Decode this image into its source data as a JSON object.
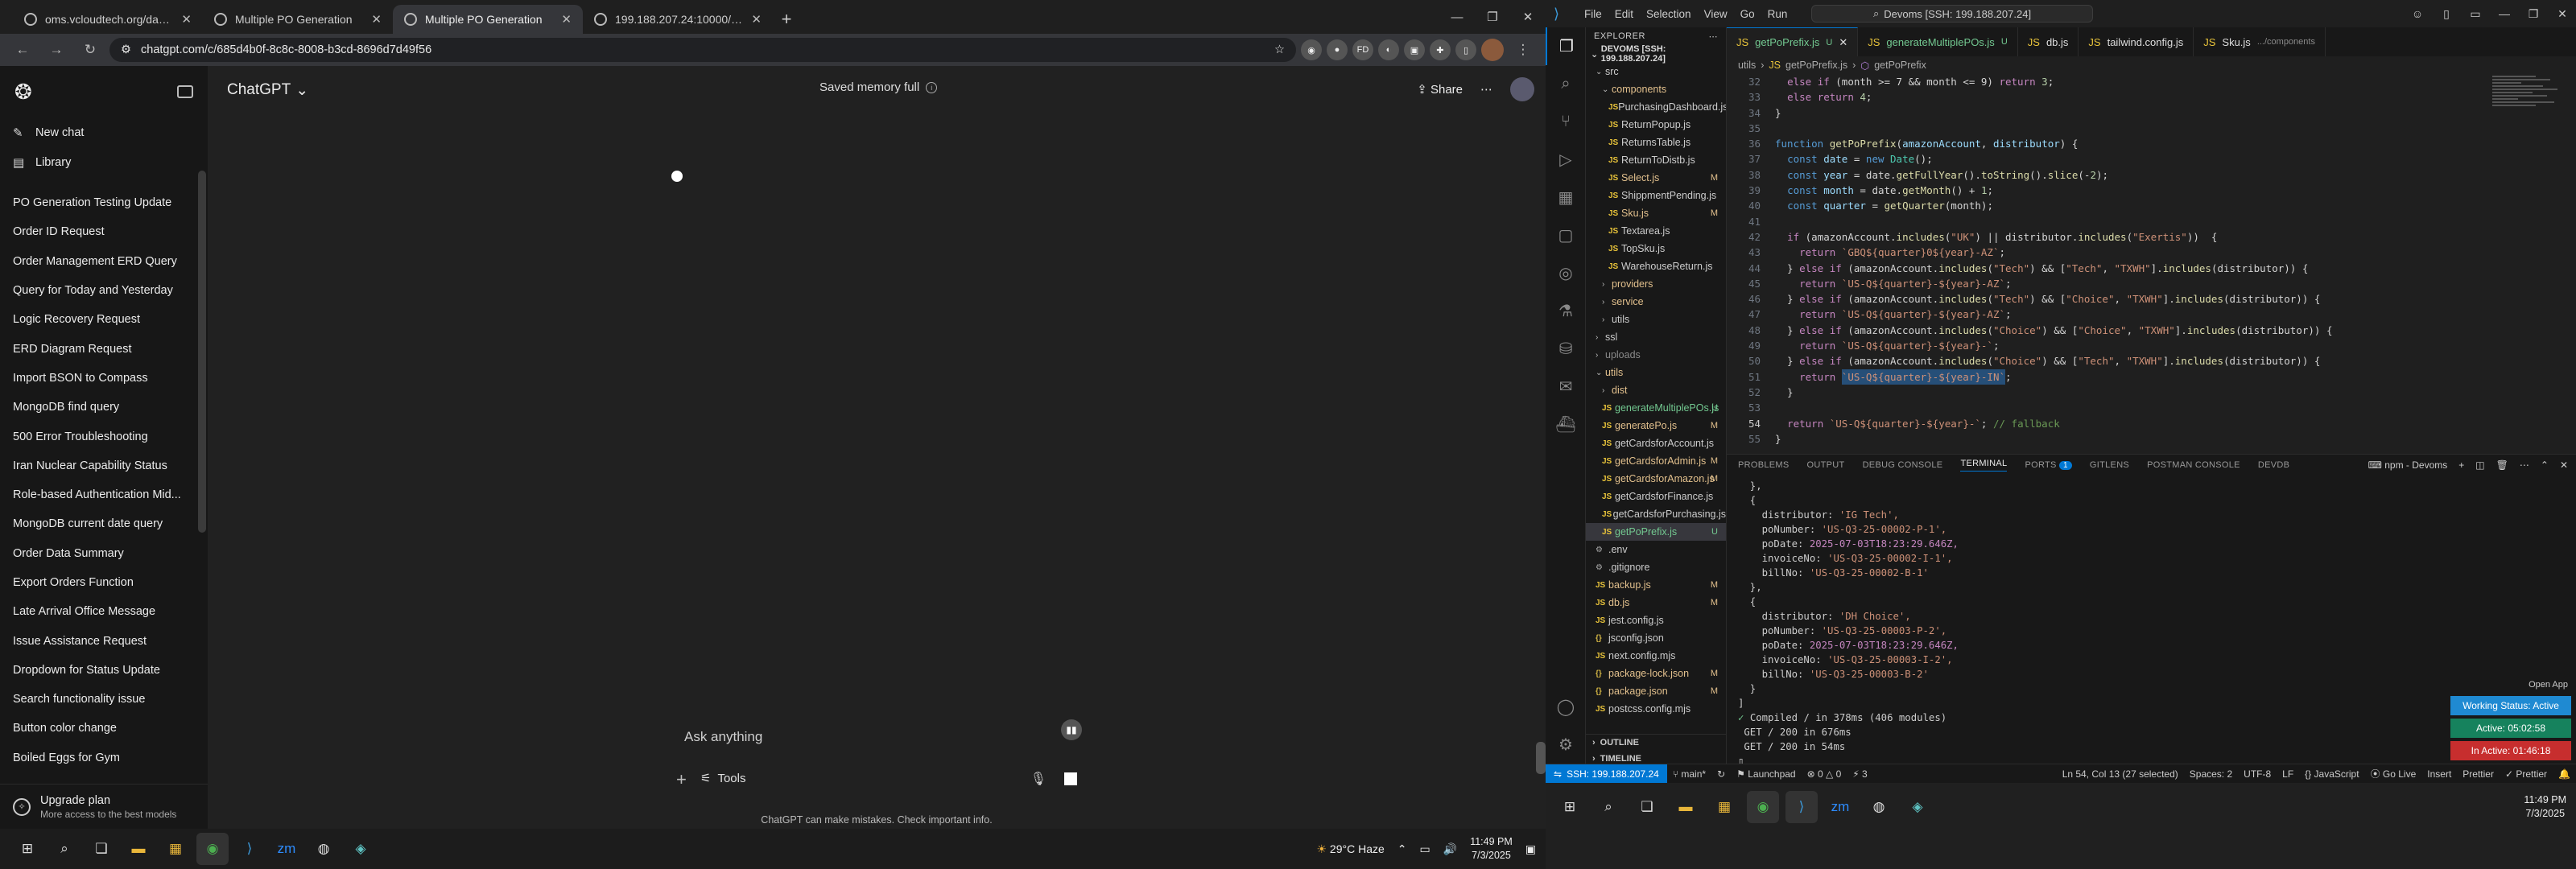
{
  "chrome": {
    "tabs": [
      {
        "title": "oms.vcloudtech.org/dashboard",
        "active": false
      },
      {
        "title": "Multiple PO Generation",
        "active": false
      },
      {
        "title": "Multiple PO Generation",
        "active": true
      },
      {
        "title": "199.188.207.24:10000/orders/0",
        "active": false
      }
    ],
    "new_tab": "+",
    "url": "chatgpt.com/c/685d4b0f-8c8c-8008-b3cd-8696d7d49f56"
  },
  "sidebar": {
    "nav": [
      {
        "label": "New chat",
        "icon": "✎"
      },
      {
        "label": "Library",
        "icon": "▤"
      }
    ],
    "chats": [
      "PO Generation Testing Update",
      "Order ID Request",
      "Order Management ERD Query",
      "Query for Today and Yesterday",
      "Logic Recovery Request",
      "ERD Diagram Request",
      "Import BSON to Compass",
      "MongoDB find query",
      "500 Error Troubleshooting",
      "Iran Nuclear Capability Status",
      "Role-based Authentication Mid...",
      "MongoDB current date query",
      "Order Data Summary",
      "Export Orders Function",
      "Late Arrival Office Message",
      "Issue Assistance Request",
      "Dropdown for Status Update",
      "Search functionality issue",
      "Button color change",
      "Boiled Eggs for Gym"
    ],
    "upgrade_title": "Upgrade plan",
    "upgrade_sub": "More access to the best models"
  },
  "main": {
    "model": "ChatGPT",
    "memory": "Saved memory full",
    "share": "Share",
    "placeholder": "Ask anything",
    "tools": "Tools",
    "disclaimer": "ChatGPT can make mistakes. Check important info."
  },
  "taskbar_left": {
    "weather": "29°C Haze",
    "time": "11:49 PM",
    "date": "7/3/2025"
  },
  "vscode": {
    "menus": [
      "File",
      "Edit",
      "Selection",
      "View",
      "Go",
      "Run"
    ],
    "command_center": "Devoms [SSH: 199.188.207.24]",
    "explorer_title": "EXPLORER",
    "project": "DEVOMS [SSH: 199.188.207.24]",
    "tree": [
      {
        "d": 1,
        "t": "folder",
        "open": true,
        "name": "src",
        "s": ""
      },
      {
        "d": 2,
        "t": "folder",
        "open": true,
        "name": "components",
        "s": "",
        "cls": "mod"
      },
      {
        "d": 3,
        "t": "js",
        "name": "PurchasingDashboard.js",
        "s": ""
      },
      {
        "d": 3,
        "t": "js",
        "name": "ReturnPopup.js",
        "s": ""
      },
      {
        "d": 3,
        "t": "js",
        "name": "ReturnsTable.js",
        "s": ""
      },
      {
        "d": 3,
        "t": "js",
        "name": "ReturnToDistb.js",
        "s": ""
      },
      {
        "d": 3,
        "t": "js",
        "name": "Select.js",
        "s": "M",
        "cls": "mod"
      },
      {
        "d": 3,
        "t": "js",
        "name": "ShippmentPending.js",
        "s": ""
      },
      {
        "d": 3,
        "t": "js",
        "name": "Sku.js",
        "s": "M",
        "cls": "mod"
      },
      {
        "d": 3,
        "t": "js",
        "name": "Textarea.js",
        "s": ""
      },
      {
        "d": 3,
        "t": "js",
        "name": "TopSku.js",
        "s": ""
      },
      {
        "d": 3,
        "t": "js",
        "name": "WarehouseReturn.js",
        "s": ""
      },
      {
        "d": 2,
        "t": "folder",
        "open": false,
        "name": "providers",
        "s": "",
        "cls": "mod"
      },
      {
        "d": 2,
        "t": "folder",
        "open": false,
        "name": "service",
        "s": "",
        "cls": "mod"
      },
      {
        "d": 2,
        "t": "folder",
        "open": false,
        "name": "utils",
        "s": ""
      },
      {
        "d": 1,
        "t": "folder",
        "open": false,
        "name": "ssl",
        "s": ""
      },
      {
        "d": 1,
        "t": "folder",
        "open": false,
        "name": "uploads",
        "s": "",
        "cls": "dim"
      },
      {
        "d": 1,
        "t": "folder",
        "open": true,
        "name": "utils",
        "s": "",
        "cls": "mod"
      },
      {
        "d": 2,
        "t": "folder",
        "open": false,
        "name": "dist",
        "s": "",
        "cls": "mod"
      },
      {
        "d": 2,
        "t": "js",
        "name": "generateMultiplePOs.js",
        "s": "U",
        "cls": "unt"
      },
      {
        "d": 2,
        "t": "js",
        "name": "generatePo.js",
        "s": "M",
        "cls": "mod"
      },
      {
        "d": 2,
        "t": "js",
        "name": "getCardsforAccount.js",
        "s": ""
      },
      {
        "d": 2,
        "t": "js",
        "name": "getCardsforAdmin.js",
        "s": "M",
        "cls": "mod"
      },
      {
        "d": 2,
        "t": "js",
        "name": "getCardsforAmazon.js",
        "s": "M",
        "cls": "mod"
      },
      {
        "d": 2,
        "t": "js",
        "name": "getCardsforFinance.js",
        "s": ""
      },
      {
        "d": 2,
        "t": "js",
        "name": "getCardsforPurchasing.js",
        "s": ""
      },
      {
        "d": 2,
        "t": "js",
        "name": "getPoPrefix.js",
        "s": "U",
        "cls": "unt",
        "sel": true
      },
      {
        "d": 1,
        "t": "cfg",
        "name": ".env",
        "s": ""
      },
      {
        "d": 1,
        "t": "cfg",
        "name": ".gitignore",
        "s": ""
      },
      {
        "d": 1,
        "t": "js",
        "name": "backup.js",
        "s": "M",
        "cls": "mod"
      },
      {
        "d": 1,
        "t": "js",
        "name": "db.js",
        "s": "M",
        "cls": "mod"
      },
      {
        "d": 1,
        "t": "js",
        "name": "jest.config.js",
        "s": ""
      },
      {
        "d": 1,
        "t": "json",
        "name": "jsconfig.json",
        "s": ""
      },
      {
        "d": 1,
        "t": "js",
        "name": "next.config.mjs",
        "s": ""
      },
      {
        "d": 1,
        "t": "json",
        "name": "package-lock.json",
        "s": "M",
        "cls": "mod"
      },
      {
        "d": 1,
        "t": "json",
        "name": "package.json",
        "s": "M",
        "cls": "mod"
      },
      {
        "d": 1,
        "t": "js",
        "name": "postcss.config.mjs",
        "s": ""
      }
    ],
    "outline": "OUTLINE",
    "timeline": "TIMELINE",
    "tabs": [
      {
        "name": "getPoPrefix.js",
        "badge": "U",
        "active": true
      },
      {
        "name": "generateMultiplePOs.js",
        "badge": "U",
        "active": false
      },
      {
        "name": "db.js",
        "badge": "",
        "active": false
      },
      {
        "name": "tailwind.config.js",
        "badge": "",
        "active": false
      },
      {
        "name": "Sku.js",
        "badge": ".../components",
        "active": false
      }
    ],
    "breadcrumb": [
      "utils",
      "getPoPrefix.js",
      "getPoPrefix"
    ],
    "code_start": 32,
    "current_line": 54,
    "panel_tabs": [
      "PROBLEMS",
      "OUTPUT",
      "DEBUG CONSOLE",
      "TERMINAL",
      "PORTS",
      "GITLENS",
      "POSTMAN CONSOLE",
      "DEVDB"
    ],
    "ports_badge": "1",
    "terminal_name": "npm - Devoms",
    "terminal": [
      {
        "k": "",
        "v": "  },"
      },
      {
        "k": "",
        "v": "  {"
      },
      {
        "k": "    distributor: ",
        "v": "'IG Tech',"
      },
      {
        "k": "    poNumber: ",
        "v": "'US-Q3-25-00002-P-1',"
      },
      {
        "k": "    poDate: ",
        "v": "2025-07-03T18:23:29.646Z,",
        "date": true
      },
      {
        "k": "    invoiceNo: ",
        "v": "'US-Q3-25-00002-I-1',"
      },
      {
        "k": "    billNo: ",
        "v": "'US-Q3-25-00002-B-1'"
      },
      {
        "k": "",
        "v": "  },"
      },
      {
        "k": "",
        "v": "  {"
      },
      {
        "k": "    distributor: ",
        "v": "'DH Choice',"
      },
      {
        "k": "    poNumber: ",
        "v": "'US-Q3-25-00003-P-2',"
      },
      {
        "k": "    poDate: ",
        "v": "2025-07-03T18:23:29.646Z,",
        "date": true
      },
      {
        "k": "    invoiceNo: ",
        "v": "'US-Q3-25-00003-I-2',"
      },
      {
        "k": "    billNo: ",
        "v": "'US-Q3-25-00003-B-2'"
      },
      {
        "k": "",
        "v": "  }"
      },
      {
        "k": "",
        "v": "]"
      },
      {
        "k": "✓ ",
        "v": "Compiled / in 378ms (406 modules)",
        "ok": true
      },
      {
        "k": "",
        "v": " GET / 200 in 676ms"
      },
      {
        "k": "",
        "v": " GET / 200 in 54ms"
      }
    ],
    "open_app": "Open App",
    "work_status": "Working Status: Active",
    "active_time": "Active: 05:02:58",
    "inactive_time": "In Active: 01:46:18",
    "status": {
      "remote": "SSH: 199.188.207.24",
      "branch": "main*",
      "problems": "0 △ 0",
      "ports": "3",
      "launchpad": "Launchpad",
      "cursor": "Ln 54, Col 13 (27 selected)",
      "spaces": "Spaces: 2",
      "encoding": "UTF-8",
      "eol": "LF",
      "lang": "JavaScript",
      "golive": "Go Live",
      "insert": "Insert",
      "prettier": "Prettier"
    }
  },
  "taskbar_right": {
    "time": "11:49 PM",
    "date": "7/3/2025"
  },
  "colors": {
    "accent": "#0078d4",
    "active": "#16825d",
    "inactive": "#c72e2e",
    "working": "#1f8ad2"
  }
}
